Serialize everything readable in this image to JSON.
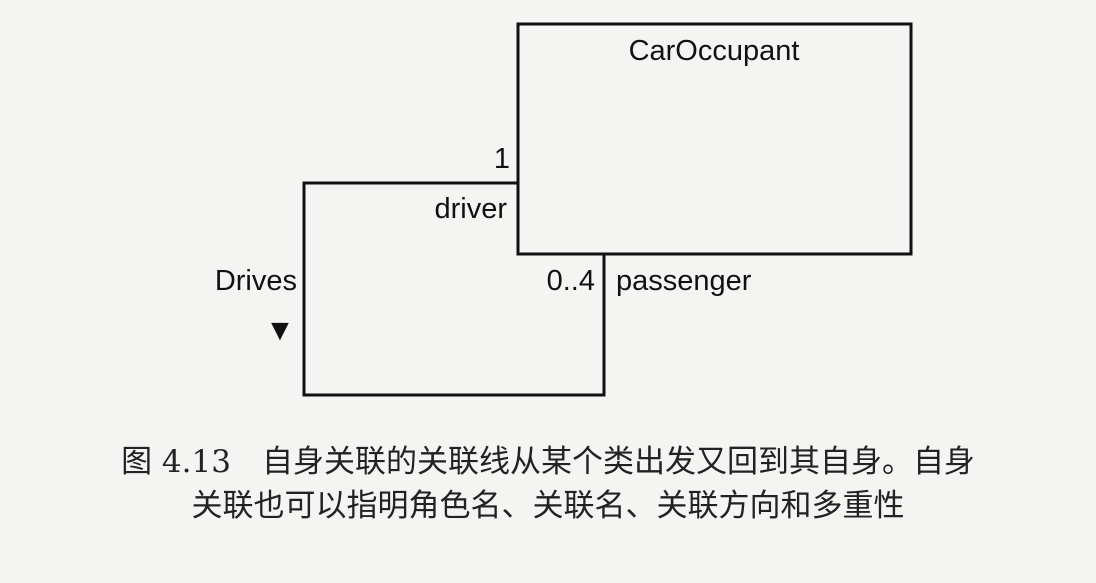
{
  "diagram": {
    "class_name": "CarOccupant",
    "association": {
      "name": "Drives",
      "direction_marker": "▼",
      "end_driver": {
        "role": "driver",
        "multiplicity": "1"
      },
      "end_passenger": {
        "role": "passenger",
        "multiplicity": "0..4"
      }
    }
  },
  "caption": {
    "line1": "图 4.13　自身关联的关联线从某个类出发又回到其自身。自身",
    "line2": "关联也可以指明角色名、关联名、关联方向和多重性"
  }
}
